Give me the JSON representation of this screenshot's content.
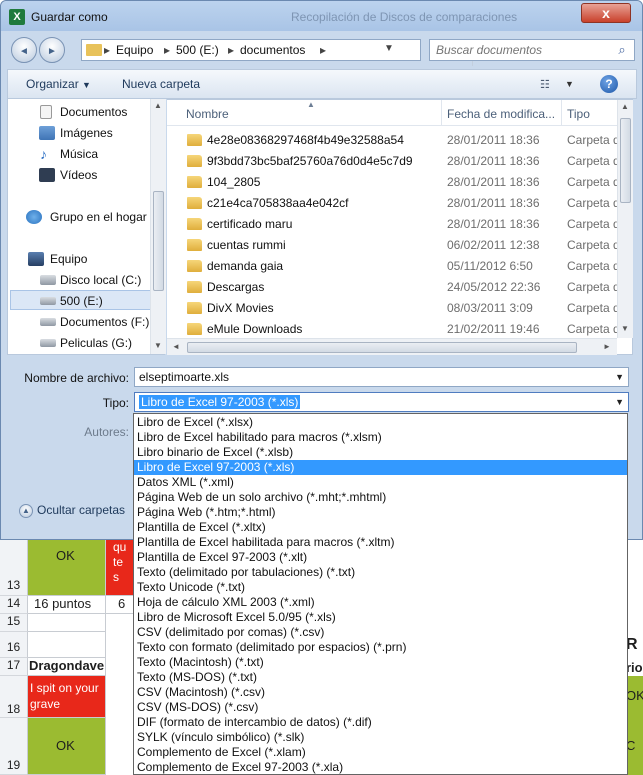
{
  "window": {
    "title": "Guardar como",
    "background_title": "Recopilación de Discos de comparaciones",
    "close_label": "x"
  },
  "nav": {
    "back_symbol": "◄",
    "forward_symbol": "►",
    "breadcrumb": [
      "Equipo",
      "500 (E:)",
      "documentos"
    ],
    "search_placeholder": "Buscar documentos"
  },
  "toolbar": {
    "organize": "Organizar",
    "new_folder": "Nueva carpeta"
  },
  "sidebar": {
    "items": [
      {
        "label": "Documentos",
        "icon": "documents-icon"
      },
      {
        "label": "Imágenes",
        "icon": "pictures-icon"
      },
      {
        "label": "Música",
        "icon": "music-icon"
      },
      {
        "label": "Vídeos",
        "icon": "videos-icon"
      },
      {
        "label": "Grupo en el hogar",
        "icon": "homegroup-icon"
      },
      {
        "label": "Equipo",
        "icon": "computer-icon"
      },
      {
        "label": "Disco local (C:)",
        "icon": "drive-icon"
      },
      {
        "label": "500 (E:)",
        "icon": "drive-icon"
      },
      {
        "label": "Documentos (F:)",
        "icon": "drive-icon"
      },
      {
        "label": "Peliculas (G:)",
        "icon": "drive-icon"
      }
    ]
  },
  "files": {
    "columns": [
      "Nombre",
      "Fecha de modifica...",
      "Tipo"
    ],
    "rows": [
      {
        "name": "4e28e08368297468f4b49e32588a54",
        "date": "28/01/2011 18:36",
        "type": "Carpeta d"
      },
      {
        "name": "9f3bdd73bc5baf25760a76d0d4e5c7d9",
        "date": "28/01/2011 18:36",
        "type": "Carpeta d"
      },
      {
        "name": "104_2805",
        "date": "28/01/2011 18:36",
        "type": "Carpeta d"
      },
      {
        "name": "c21e4ca705838aa4e042cf",
        "date": "28/01/2011 18:36",
        "type": "Carpeta d"
      },
      {
        "name": "certificado maru",
        "date": "28/01/2011 18:36",
        "type": "Carpeta d"
      },
      {
        "name": "cuentas rummi",
        "date": "06/02/2011 12:38",
        "type": "Carpeta d"
      },
      {
        "name": "demanda gaia",
        "date": "05/11/2012 6:50",
        "type": "Carpeta d"
      },
      {
        "name": "Descargas",
        "date": "24/05/2012 22:36",
        "type": "Carpeta d"
      },
      {
        "name": "DivX Movies",
        "date": "08/03/2011 3:09",
        "type": "Carpeta d"
      },
      {
        "name": "eMule Downloads",
        "date": "21/02/2011 19:46",
        "type": "Carpeta d"
      }
    ]
  },
  "form": {
    "filename_label": "Nombre de archivo:",
    "filename_value": "elseptimoarte.xls",
    "type_label": "Tipo:",
    "type_value": "Libro de Excel 97-2003 (*.xls)",
    "authors_label": "Autores:",
    "hide_folders": "Ocultar carpetas"
  },
  "dropdown": {
    "selected_index": 3,
    "options": [
      "Libro de Excel (*.xlsx)",
      "Libro de Excel habilitado para macros (*.xlsm)",
      "Libro binario de Excel (*.xlsb)",
      "Libro de Excel 97-2003 (*.xls)",
      "Datos XML (*.xml)",
      "Página Web de un solo archivo (*.mht;*.mhtml)",
      "Página Web (*.htm;*.html)",
      "Plantilla de Excel (*.xltx)",
      "Plantilla de Excel habilitada para macros (*.xltm)",
      "Plantilla de Excel 97-2003 (*.xlt)",
      "Texto (delimitado por tabulaciones) (*.txt)",
      "Texto Unicode (*.txt)",
      "Hoja de cálculo XML 2003 (*.xml)",
      "Libro de Microsoft Excel 5.0/95 (*.xls)",
      "CSV (delimitado por comas) (*.csv)",
      "Texto con formato (delimitado por espacios) (*.prn)",
      "Texto (Macintosh) (*.txt)",
      "Texto (MS-DOS) (*.txt)",
      "CSV (Macintosh) (*.csv)",
      "CSV (MS-DOS) (*.csv)",
      "DIF (formato de intercambio de datos) (*.dif)",
      "SYLK (vínculo simbólico) (*.slk)",
      "Complemento de Excel (*.xlam)",
      "Complemento de Excel 97-2003 (*.xla)"
    ]
  },
  "sheet": {
    "rows": [
      "13",
      "14",
      "15",
      "16",
      "17",
      "18",
      "19"
    ],
    "cell_ok": "OK",
    "cell_14a": "16 puntos",
    "cell_14b": "6 p",
    "cell_17a": "Dragondave",
    "cell_18a": "I spit on your grave",
    "cell_top_b": "qu te s",
    "cell_16_right": "R",
    "cell_17_right": "rio",
    "cell_18_right": "OK",
    "cell_19_right": "C"
  },
  "colors": {
    "selection": "#3399ff",
    "green_cell": "#9bbb31",
    "red_cell": "#e8281a",
    "dialog_bg": "#c9d9ec"
  }
}
